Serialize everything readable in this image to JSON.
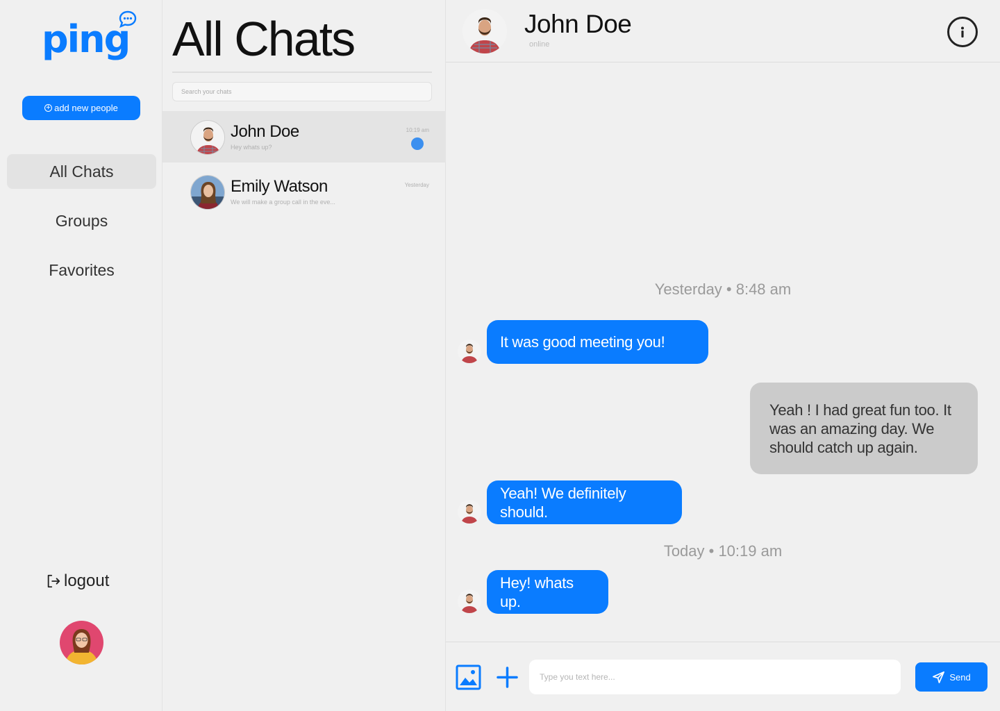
{
  "app": {
    "logo": "ping",
    "brand_color": "#0a7cff"
  },
  "sidebar": {
    "add_button": "add new people",
    "items": [
      {
        "label": "All Chats",
        "active": true
      },
      {
        "label": "Groups",
        "active": false
      },
      {
        "label": "Favorites",
        "active": false
      }
    ],
    "logout": "logout"
  },
  "chatlist": {
    "title": "All Chats",
    "search_placeholder": "Search your chats",
    "chats": [
      {
        "name": "John Doe",
        "preview": "Hey whats up?",
        "time": "10:19 am",
        "unread": true,
        "active": true
      },
      {
        "name": "Emily Watson",
        "preview": "We will make a group call in the eve...",
        "time": "Yesterday",
        "unread": false,
        "active": false
      }
    ]
  },
  "conversation": {
    "contact_name": "John Doe",
    "status": "online",
    "timestamps": {
      "first": "Yesterday • 8:48 am",
      "second": "Today • 10:19 am"
    },
    "messages": [
      {
        "from": "them",
        "text": "It was good meeting you!"
      },
      {
        "from": "me",
        "text": "Yeah ! I had great fun too. It was an amazing day. We should catch up again."
      },
      {
        "from": "them",
        "text": "Yeah! We definitely should."
      },
      {
        "from": "them",
        "text": "Hey! whats up."
      }
    ],
    "composer": {
      "placeholder": "Type you text here...",
      "send_label": "Send"
    }
  },
  "icons": {
    "logo_bubble": "chat-bubble-icon",
    "add": "plus-circle-icon",
    "logout": "logout-icon",
    "info": "info-icon",
    "image": "image-icon",
    "plus": "plus-icon",
    "send": "paper-plane-icon"
  }
}
